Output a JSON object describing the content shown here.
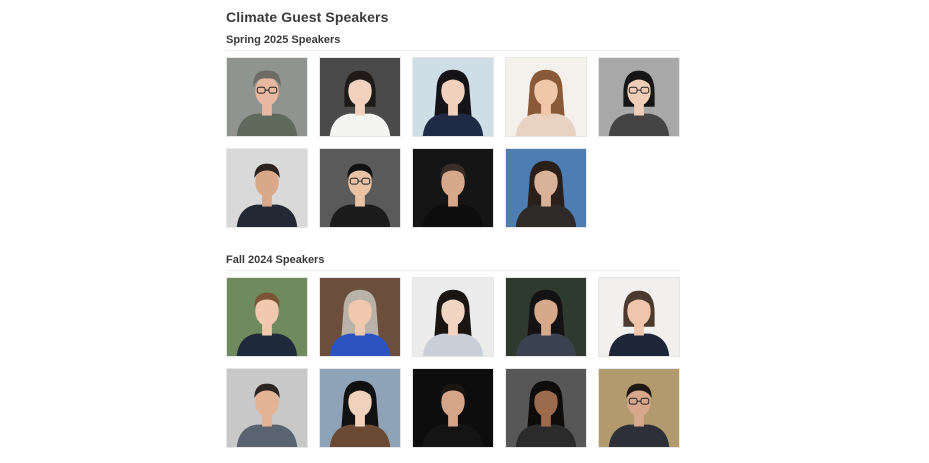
{
  "page": {
    "title": "Climate Guest Speakers"
  },
  "sections": [
    {
      "heading": "Spring 2025 Speakers",
      "speakers": [
        {
          "bg": "#8f9490",
          "skin": "#e8b9a0",
          "hair": "#6e6a66",
          "shirt": "#5f6a5c",
          "hair_style": "short-curly",
          "glasses": true
        },
        {
          "bg": "#4a4a4a",
          "skin": "#f0d2bf",
          "hair": "#1e1a18",
          "shirt": "#f4f4f2",
          "hair_style": "bob",
          "glasses": false
        },
        {
          "bg": "#cfdde6",
          "skin": "#f1d0bd",
          "hair": "#141418",
          "shirt": "#1f2b44",
          "hair_style": "long",
          "glasses": false
        },
        {
          "bg": "#f4f1ec",
          "skin": "#f0c7a8",
          "hair": "#8a5a38",
          "shirt": "#e9d2c2",
          "hair_style": "long",
          "glasses": false
        },
        {
          "bg": "#a8a8a8",
          "skin": "#f0cdb6",
          "hair": "#151515",
          "shirt": "#444",
          "hair_style": "bob",
          "glasses": true
        },
        {
          "bg": "#d9d9d9",
          "skin": "#d9a888",
          "hair": "#2b2320",
          "shirt": "#222834",
          "hair_style": "short",
          "glasses": false
        },
        {
          "bg": "#5a5a5a",
          "skin": "#e9c3a6",
          "hair": "#111",
          "shirt": "#1c1c1c",
          "hair_style": "short",
          "glasses": true
        },
        {
          "bg": "#151515",
          "skin": "#d6a98c",
          "hair": "#3a2e28",
          "shirt": "#0d0d0d",
          "hair_style": "short",
          "glasses": false
        },
        {
          "bg": "#4d7db3",
          "skin": "#d9b29a",
          "hair": "#2a1f1a",
          "shirt": "#2e2a28",
          "hair_style": "long",
          "glasses": false
        }
      ]
    },
    {
      "heading": "Fall 2024 Speakers",
      "speakers": [
        {
          "bg": "#6f8a5c",
          "skin": "#f1c9ae",
          "hair": "#7a5636",
          "shirt": "#1f2a3a",
          "hair_style": "short",
          "glasses": false
        },
        {
          "bg": "#6b4e3c",
          "skin": "#f0c8ae",
          "hair": "#b9b2a8",
          "shirt": "#2d53c2",
          "hair_style": "long",
          "glasses": false
        },
        {
          "bg": "#ececec",
          "skin": "#f2d4c2",
          "hair": "#1a1512",
          "shirt": "#c9cfd8",
          "hair_style": "long",
          "glasses": false
        },
        {
          "bg": "#2f3a2e",
          "skin": "#d7a98b",
          "hair": "#141212",
          "shirt": "#3a4250",
          "hair_style": "long",
          "glasses": false
        },
        {
          "bg": "#f2f0ef",
          "skin": "#efc6ac",
          "hair": "#4b3a30",
          "shirt": "#1c2638",
          "hair_style": "bob",
          "glasses": false
        },
        {
          "bg": "#c8c8c8",
          "skin": "#e2b495",
          "hair": "#2c2420",
          "shirt": "#5a6470",
          "hair_style": "short",
          "glasses": false
        },
        {
          "bg": "#8fa3b8",
          "skin": "#f2d2bd",
          "hair": "#111",
          "shirt": "#6b4a35",
          "hair_style": "long",
          "glasses": false
        },
        {
          "bg": "#0d0d0d",
          "skin": "#d5a58a",
          "hair": "#1c1613",
          "shirt": "#141414",
          "hair_style": "short",
          "glasses": false
        },
        {
          "bg": "#575757",
          "skin": "#9c6a4d",
          "hair": "#0f0d0c",
          "shirt": "#2b2b2b",
          "hair_style": "long",
          "glasses": false
        },
        {
          "bg": "#b09a6e",
          "skin": "#d6a78a",
          "hair": "#1e1814",
          "shirt": "#2d3038",
          "hair_style": "short",
          "glasses": true
        }
      ]
    }
  ]
}
